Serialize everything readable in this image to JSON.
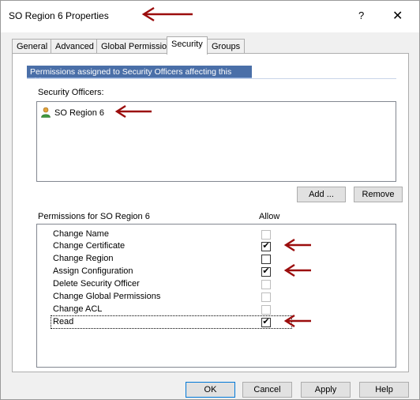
{
  "window": {
    "title": "SO Region 6 Properties",
    "help_glyph": "?",
    "close_glyph": "✕"
  },
  "tabs": [
    {
      "label": "General",
      "active": false
    },
    {
      "label": "Advanced",
      "active": false
    },
    {
      "label": "Global Permissions",
      "active": false
    },
    {
      "label": "Security",
      "active": true
    },
    {
      "label": "Groups",
      "active": false
    }
  ],
  "security_tab": {
    "banner": "Permissions assigned to Security Officers affecting this object",
    "officers_label": "Security Officers:",
    "officers": [
      {
        "name": "SO Region 6",
        "icon": "user-icon"
      }
    ],
    "add_label": "Add ...",
    "remove_label": "Remove",
    "permissions_label": "Permissions for SO Region 6",
    "allow_label": "Allow",
    "permissions": [
      {
        "name": "Change Name",
        "checked": false,
        "enabled": false
      },
      {
        "name": "Change Certificate",
        "checked": true,
        "enabled": true
      },
      {
        "name": "Change Region",
        "checked": false,
        "enabled": true
      },
      {
        "name": "Assign Configuration",
        "checked": true,
        "enabled": true
      },
      {
        "name": "Delete Security Officer",
        "checked": false,
        "enabled": false
      },
      {
        "name": "Change Global Permissions",
        "checked": false,
        "enabled": false
      },
      {
        "name": "Change ACL",
        "checked": false,
        "enabled": false
      },
      {
        "name": "Read",
        "checked": true,
        "enabled": true
      }
    ]
  },
  "footer": {
    "ok_label": "OK",
    "cancel_label": "Cancel",
    "apply_label": "Apply",
    "help_label": "Help"
  },
  "colors": {
    "banner_bg": "#4a6fa8",
    "annotation_arrow": "#9b0d0d"
  }
}
